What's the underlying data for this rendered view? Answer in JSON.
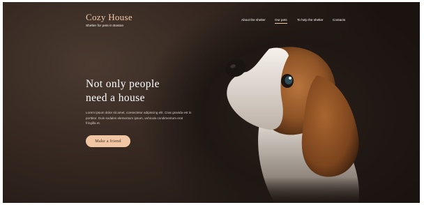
{
  "logo": {
    "title": "Cozy House",
    "subtitle": "Shelter for pets in Boston"
  },
  "nav": {
    "items": [
      {
        "label": "About the shelter"
      },
      {
        "label": "Our pets",
        "active": true
      },
      {
        "label": "To help the shelter"
      },
      {
        "label": "Contacts"
      }
    ]
  },
  "hero": {
    "title_line1": "Not only people",
    "title_line2": "need a house",
    "text": "Lorem ipsum dolor sit amet, consectetur adipiscing elit. Cras gravida est in porttitor. Duis sodales elementum ipsum, vehicula condimentum erat fringilla et.",
    "cta_label": "Make a friend"
  },
  "image": {
    "subject": "beagle-puppy"
  },
  "colors": {
    "accent": "#f1c6a4",
    "background": "#2b211b",
    "text": "#ffffff"
  }
}
